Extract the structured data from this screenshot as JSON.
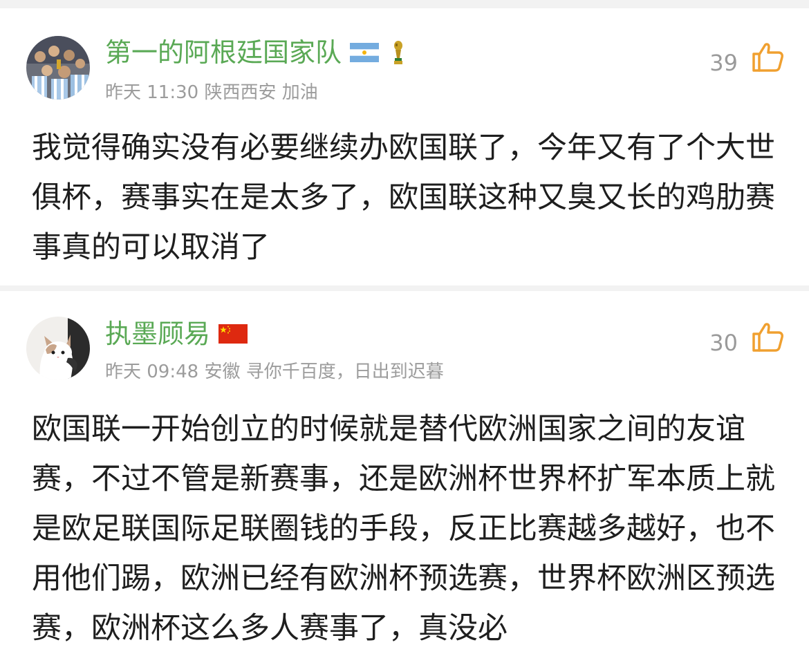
{
  "comments": [
    {
      "username": "第一的阿根廷国家队",
      "flag": "argentina-flag-icon",
      "badge": "world-cup-trophy-icon",
      "time": "昨天 11:30",
      "location": "陕西西安",
      "signature": "加油",
      "likes": "39",
      "text": "我觉得确实没有必要继续办欧国联了，今年又有了个大世俱杯，赛事实在是太多了，欧国联这种又臭又长的鸡肋赛事真的可以取消了"
    },
    {
      "username": "执墨顾易",
      "flag": "china-flag-icon",
      "time": "昨天 09:48",
      "location": "安徽",
      "signature": "寻你千百度，日出到迟暮",
      "likes": "30",
      "text": "欧国联一开始创立的时候就是替代欧洲国家之间的友谊赛，不过不管是新赛事，还是欧洲杯世界杯扩军本质上就是欧足联国际足联圈钱的手段，反正比赛越多越好，也不用他们踢，欧洲已经有欧洲杯预选赛，世界杯欧洲区预选赛，欧洲杯这么多人赛事了，真没必"
    }
  ],
  "colors": {
    "username": "#5aa955",
    "meta": "#9c9c9c",
    "like_icon": "#f0a030",
    "body": "#1e1e1e",
    "divider": "#f2f2f2"
  }
}
